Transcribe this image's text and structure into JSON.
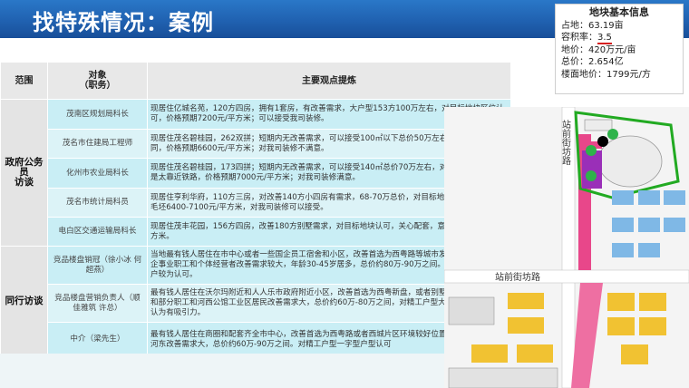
{
  "header": {
    "title": "找特殊情况：案例"
  },
  "info_box": {
    "title": "地块基本信息",
    "lines": {
      "area": "占地：63.19亩",
      "far_label": "容积率：",
      "far_value": "3.5",
      "land_price": "地价：420万元/亩",
      "total_price": "总价：2.654亿",
      "floor_price": "楼面地价：1799元/方"
    }
  },
  "table": {
    "headers": {
      "scope": "范围",
      "object": "对象\n（职务）",
      "view": "主要观点提炼"
    },
    "groups": [
      {
        "label": "政府公务员\n访谈",
        "rows": [
          {
            "object": "茂南区规划局科长",
            "view": "现居住亿城名苑，120方四房，拥有1套房，有改善需求，大户型153方100万左右，对目标地块区位认可，价格预期7200元/平方米；可以接受我司装修。"
          },
          {
            "object": "茂名市住建局工程师",
            "view": "现居住茂名碧桂园，262双拼；短期内无改善需求，可以接受100㎡以下总价50万左右，对该地块认同，价格预期6600元/平方米；对我司装修不满意。"
          },
          {
            "object": "化州市农业局科长",
            "view": "现居住茂名碧桂园，173四拼；短期内无改善需求，可以接受140㎡总价70万左右，对该地块认同，但是太靠近铁路，价格预期7000元/平方米；对我司装修满意。"
          },
          {
            "object": "茂名市统计局科员",
            "view": "现居住亨利华府，110方三房，对改善140方小四房有需求，68-70万总价，对目标地块认同，意向价格毛坯6400-7100元/平方米，对我司装修可以接受。"
          },
          {
            "object": "电白区交通运输局科长",
            "view": "现居住茂丰花园，156方四房，改善180方别墅需求，对目标地块认可，关心配套，意向价格7400元/平方米。"
          }
        ]
      },
      {
        "label": "同行访谈",
        "rows": [
          {
            "object": "竞品楼盘销冠（徐小冰 何超燕）",
            "view": "当地最有钱人居住在市中心或者一些国企员工宿舍和小区，改善首选为西粤路等城市发展方向，一些国企事业职工和个体经营者改善需求较大，年龄30-45岁居多，总价约80万-90万之间。对精工户型一梯两户较为认可。"
          },
          {
            "object": "竞品楼盘营销负责人（顺佳雅筑 许总）",
            "view": "最有钱人居住在沃尔玛附近和人人乐市政府附近小区，改善首选为西粤新盘，或者别墅楼盘，国企高管和部分职工和河西公馆工业区居民改善需求大，总价约60万-80万之间，对精工户型大面积比较认可，认为有吸引力。"
          },
          {
            "object": "中介（梁先生）",
            "view": "最有钱人居住在商圈和配套齐全市中心，改善首选为西粤路或者西城片区环境较好位置，工业区居民和河东改善需求大，总价约60万-90万之间。对精工户型一字型户型认可"
          }
        ]
      }
    ]
  },
  "map": {
    "road_vertical": "站前街坊路",
    "road_horizontal": "站前街坊路"
  },
  "colors": {
    "header": "#1f5fae",
    "cell": "#c9eef5",
    "cell_alt": "#dcf3f7",
    "highlight": "#d62020",
    "site_border": "#22aa22"
  }
}
